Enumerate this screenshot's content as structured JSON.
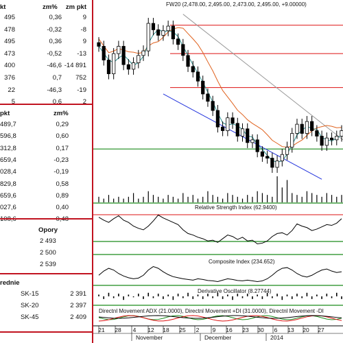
{
  "table1": {
    "headers": [
      "kt",
      "zm%",
      "zm pkt"
    ],
    "rows": [
      [
        "495",
        "0,36",
        "9"
      ],
      [
        "478",
        "-0,32",
        "-8"
      ],
      [
        "495",
        "0,36",
        "9"
      ],
      [
        "473",
        "-0,52",
        "-13"
      ],
      [
        "400",
        "-46,6",
        "-14 891"
      ],
      [
        "376",
        "0,7",
        "752"
      ],
      [
        "22",
        "-46,3",
        "-19"
      ],
      [
        "5",
        "0,6",
        "2"
      ]
    ]
  },
  "table2": {
    "headers": [
      "pkt",
      "zm%"
    ],
    "rows": [
      [
        "489,7",
        "0,29"
      ],
      [
        "596,8",
        "0,60"
      ],
      [
        "312,8",
        "0,17"
      ],
      [
        "659,4",
        "-0,23"
      ],
      [
        "028,4",
        "-0,19"
      ],
      [
        "829,8",
        "0,58"
      ],
      [
        "659,6",
        "0,89"
      ],
      [
        "027,6",
        "0,40"
      ],
      [
        "108,6",
        "0,48"
      ]
    ]
  },
  "table3": {
    "header": "Opory",
    "values": [
      "2 493",
      "2 500",
      "2 539"
    ]
  },
  "table4": {
    "header": "rednie",
    "rows": [
      [
        "SK-15",
        "2 391"
      ],
      [
        "SK-20",
        "2 397"
      ],
      [
        "SK-45",
        "2 409"
      ]
    ]
  },
  "chart_data": {
    "type": "candlestick",
    "title": "FW20 (2,478.00, 2,495.00, 2,473.00, 2,495.00, +9.00000)",
    "price_series": [
      2470,
      2455,
      2440,
      2462,
      2470,
      2450,
      2445,
      2452,
      2460,
      2465,
      2495,
      2488,
      2482,
      2487,
      2492,
      2478,
      2472,
      2460,
      2448,
      2442,
      2432,
      2418,
      2410,
      2400,
      2382,
      2378,
      2392,
      2386,
      2372,
      2380,
      2365,
      2368,
      2355,
      2350,
      2348,
      2338,
      2345,
      2352,
      2360,
      2375,
      2385,
      2375,
      2388,
      2378,
      2372,
      2362,
      2370,
      2368,
      2372,
      2378
    ],
    "price_range": [
      2320,
      2510
    ],
    "resistance_levels": [
      2493,
      2462,
      2425
    ],
    "support_level": 2358,
    "x_labels": [
      "21",
      "28",
      "4",
      "12",
      "18",
      "25",
      "2",
      "9",
      "16",
      "23",
      "30",
      "6",
      "13",
      "20",
      "27"
    ],
    "month_labels": [
      "November",
      "December",
      "2014"
    ],
    "volume": [
      3,
      2,
      4,
      2,
      3,
      2,
      3,
      5,
      2,
      3,
      6,
      4,
      3,
      2,
      4,
      3,
      2,
      5,
      3,
      4,
      2,
      3,
      6,
      4,
      3,
      2,
      5,
      4,
      3,
      2,
      4,
      3,
      6,
      5,
      4,
      3,
      14,
      8,
      12,
      5,
      4,
      3,
      6,
      5,
      4,
      3,
      5,
      4,
      3,
      4
    ],
    "indicators": [
      {
        "name": "Relative Strength Index (62.9400)",
        "values": [
          62,
          58,
          55,
          60,
          64,
          58,
          55,
          50,
          47,
          45,
          50,
          57,
          65,
          61,
          58,
          55,
          52,
          45,
          40,
          38,
          35,
          33,
          30,
          31,
          28,
          33,
          38,
          36,
          32,
          35,
          30,
          31,
          26,
          27,
          30,
          36,
          40,
          41,
          38,
          44,
          53,
          50,
          48,
          44,
          46,
          49,
          52,
          51,
          54,
          60
        ]
      },
      {
        "name": "Composite Index (234.652)",
        "values": [
          40,
          52,
          60,
          55,
          45,
          38,
          33,
          30,
          32,
          40,
          55,
          65,
          60,
          50,
          42,
          36,
          33,
          30,
          28,
          26,
          30,
          28,
          25,
          24,
          22,
          26,
          30,
          28,
          25,
          24,
          26,
          24,
          22,
          24,
          30,
          40,
          52,
          60,
          62,
          55,
          45,
          38,
          35,
          40,
          48,
          55,
          58,
          52,
          48,
          50
        ]
      },
      {
        "name": "Derivative Oscillator (8.27744)",
        "values": [
          2,
          -3,
          4,
          -2,
          3,
          -4,
          2,
          -1,
          3,
          -3,
          4,
          -2,
          3,
          -3,
          2,
          -4,
          3,
          -2,
          4,
          -3,
          2,
          -3,
          3,
          -2,
          4,
          -3,
          2,
          -4,
          3,
          -2,
          3,
          -3,
          2,
          -3,
          4,
          -2,
          3,
          -4,
          2,
          -3,
          3,
          -2,
          4,
          -3,
          2,
          -3,
          3,
          -2,
          4,
          -3
        ]
      },
      {
        "name": "Directnl Movement ADX (21.0000), Directnl Movement +DI (31.0000), Directnl Movement -DI",
        "values": []
      }
    ]
  }
}
